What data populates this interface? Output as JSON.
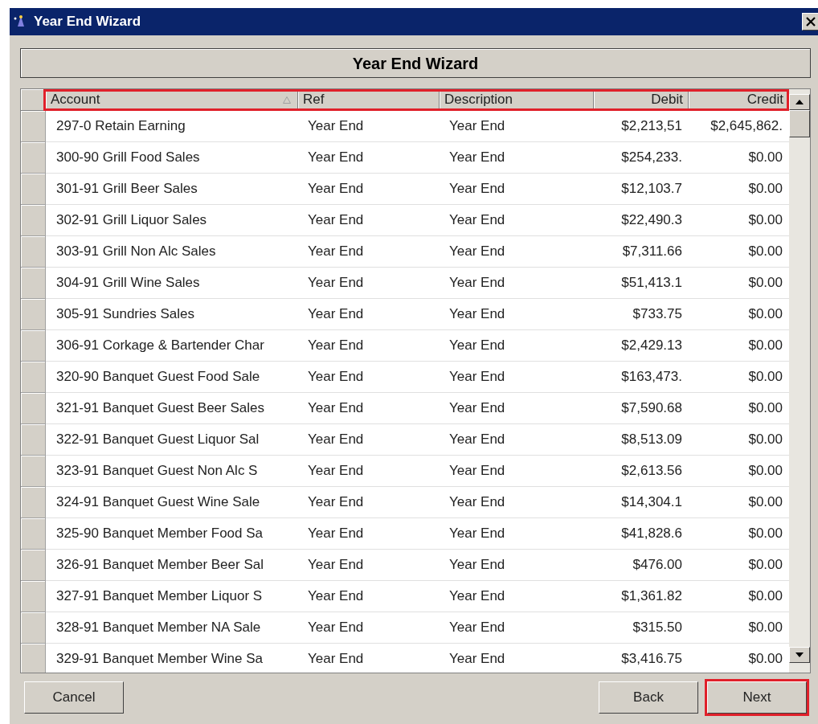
{
  "window": {
    "title": "Year End Wizard"
  },
  "header": {
    "title": "Year End Wizard"
  },
  "table": {
    "highlighted": true,
    "columns": [
      {
        "label": "Account",
        "kind": "text",
        "sorted": true
      },
      {
        "label": "Ref",
        "kind": "text",
        "sorted": false
      },
      {
        "label": "Description",
        "kind": "text",
        "sorted": false
      },
      {
        "label": "Debit",
        "kind": "money",
        "sorted": false
      },
      {
        "label": "Credit",
        "kind": "money",
        "sorted": false
      }
    ],
    "rows": [
      [
        "297-0 Retain Earning",
        "Year End",
        "Year End",
        "$2,213,51",
        "$2,645,862."
      ],
      [
        "300-90 Grill Food Sales",
        "Year End",
        "Year End",
        "$254,233.",
        "$0.00"
      ],
      [
        "301-91 Grill Beer Sales",
        "Year End",
        "Year End",
        "$12,103.7",
        "$0.00"
      ],
      [
        "302-91 Grill Liquor Sales",
        "Year End",
        "Year End",
        "$22,490.3",
        "$0.00"
      ],
      [
        "303-91 Grill Non Alc Sales",
        "Year End",
        "Year End",
        "$7,311.66",
        "$0.00"
      ],
      [
        "304-91 Grill Wine Sales",
        "Year End",
        "Year End",
        "$51,413.1",
        "$0.00"
      ],
      [
        "305-91 Sundries Sales",
        "Year End",
        "Year End",
        "$733.75",
        "$0.00"
      ],
      [
        "306-91 Corkage & Bartender Char",
        "Year End",
        "Year End",
        "$2,429.13",
        "$0.00"
      ],
      [
        "320-90 Banquet Guest Food Sale",
        "Year End",
        "Year End",
        "$163,473.",
        "$0.00"
      ],
      [
        "321-91 Banquet Guest Beer Sales",
        "Year End",
        "Year End",
        "$7,590.68",
        "$0.00"
      ],
      [
        "322-91 Banquet Guest Liquor Sal",
        "Year End",
        "Year End",
        "$8,513.09",
        "$0.00"
      ],
      [
        "323-91 Banquet Guest Non Alc S",
        "Year End",
        "Year End",
        "$2,613.56",
        "$0.00"
      ],
      [
        "324-91 Banquet Guest Wine Sale",
        "Year End",
        "Year End",
        "$14,304.1",
        "$0.00"
      ],
      [
        "325-90 Banquet Member Food Sa",
        "Year End",
        "Year End",
        "$41,828.6",
        "$0.00"
      ],
      [
        "326-91 Banquet Member Beer Sal",
        "Year End",
        "Year End",
        "$476.00",
        "$0.00"
      ],
      [
        "327-91 Banquet Member Liquor S",
        "Year End",
        "Year End",
        "$1,361.82",
        "$0.00"
      ],
      [
        "328-91 Banquet Member NA Sale",
        "Year End",
        "Year End",
        "$315.50",
        "$0.00"
      ],
      [
        "329-91 Banquet Member Wine Sa",
        "Year End",
        "Year End",
        "$3,416.75",
        "$0.00"
      ]
    ]
  },
  "buttons": [
    {
      "label": "Cancel",
      "highlighted": false
    },
    {
      "label": "Back",
      "highlighted": false
    },
    {
      "label": "Next",
      "highlighted": true
    }
  ]
}
